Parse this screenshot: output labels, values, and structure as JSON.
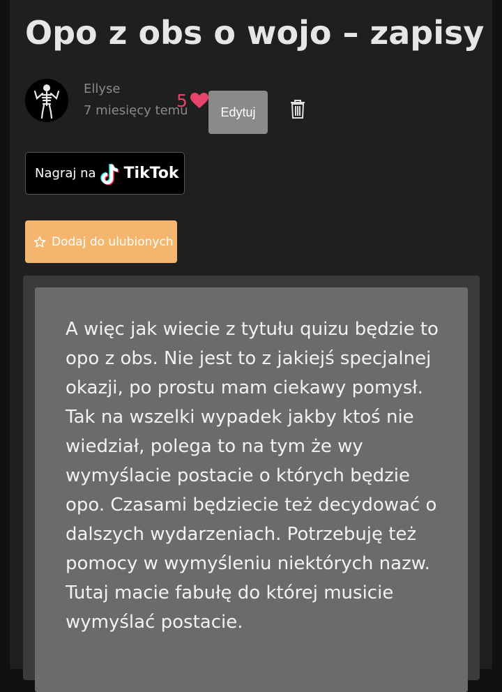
{
  "post": {
    "title": "Opo z obs o wojo – zapisy",
    "author": "Ellyse",
    "time_ago": "7 miesięcy temu",
    "likes": "5",
    "edit_label": "Edytuj"
  },
  "tiktok": {
    "prefix": "Nagraj na",
    "brand": "TikTok"
  },
  "favorite": {
    "label": "Dodaj do ulubionych"
  },
  "content": {
    "text": "A więc jak wiecie z tytułu quizu będzie to opo z obs. Nie jest to z jakiejś specjalnej okazji, po prostu mam ciekawy pomysł. Tak na wszelki wypadek jakby ktoś nie wiedział, polega to na tym że wy wymyślacie postacie o których będzie opo. Czasami będziecie też decydować o dalszych wydarzeniach. Potrzebuję też pomocy w wymyśleniu niektórych nazw. Tutaj macie fabułę do której musicie wymyślać postacie."
  },
  "colors": {
    "heart": "#e8436b",
    "favorite_button": "#f4b66e",
    "edit_button": "#8a8a8a"
  },
  "icons": {
    "heart": "heart-icon",
    "trash": "trash-icon",
    "star": "star-outline-icon",
    "tiktok": "tiktok-logo-icon",
    "avatar": "skeleton-avatar"
  }
}
